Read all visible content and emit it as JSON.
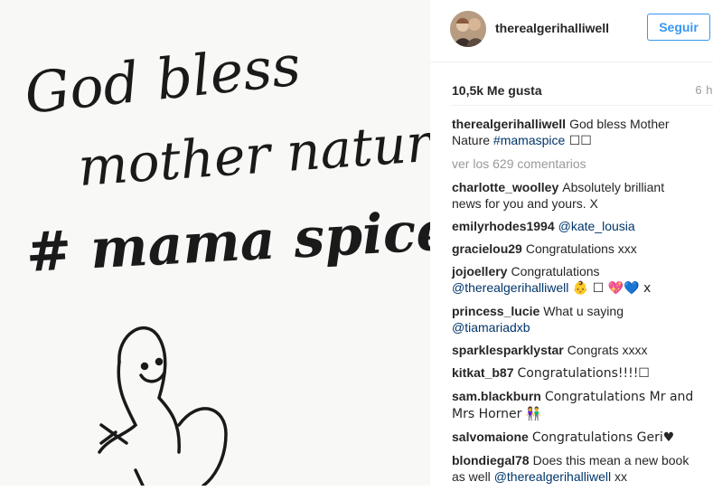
{
  "post": {
    "image_text": {
      "line1": "God bless",
      "line2": "mother nature",
      "line3": "# mama spice"
    }
  },
  "header": {
    "username": "therealgerihalliwell",
    "follow_label": "Seguir"
  },
  "stats": {
    "likes": "10,5k Me gusta",
    "time_ago": "6 h"
  },
  "caption": {
    "user": "therealgerihalliwell",
    "text": "God bless Mother Nature ",
    "hashtag": "#mamaspice",
    "trailing": " ☐☐"
  },
  "view_all_label": "ver los 629 comentarios",
  "comments": [
    {
      "user": "charlotte_woolley",
      "text": "Absolutely brilliant news for you and yours. X",
      "mention": ""
    },
    {
      "user": "emilyrhodes1994",
      "text": "",
      "mention": "@kate_lousia"
    },
    {
      "user": "gracielou29",
      "text": "Congratulations xxx",
      "mention": ""
    },
    {
      "user": "jojoellery",
      "text": "Congratulations ",
      "mention": "@therealgerihalliwell",
      "after": " 👶 ☐ 💖💙 x"
    },
    {
      "user": "princess_lucie",
      "text": "What u saying ",
      "mention": "@tiamariadxb"
    },
    {
      "user": "sparklesparklystar",
      "text": "Congrats xxxx",
      "mention": ""
    },
    {
      "user": "kitkat_b87",
      "text": "Congratulations!!!!☐",
      "mention": ""
    },
    {
      "user": "sam.blackburn",
      "text": "Congratulations Mr and Mrs Horner 👫",
      "mention": ""
    },
    {
      "user": "salvomaione",
      "text": "Congratulations Geri♥",
      "mention": ""
    },
    {
      "user": "blondiegal78",
      "text": "Does this mean a new book as well ",
      "mention": "@therealgerihalliwell",
      "after": " xx"
    }
  ]
}
